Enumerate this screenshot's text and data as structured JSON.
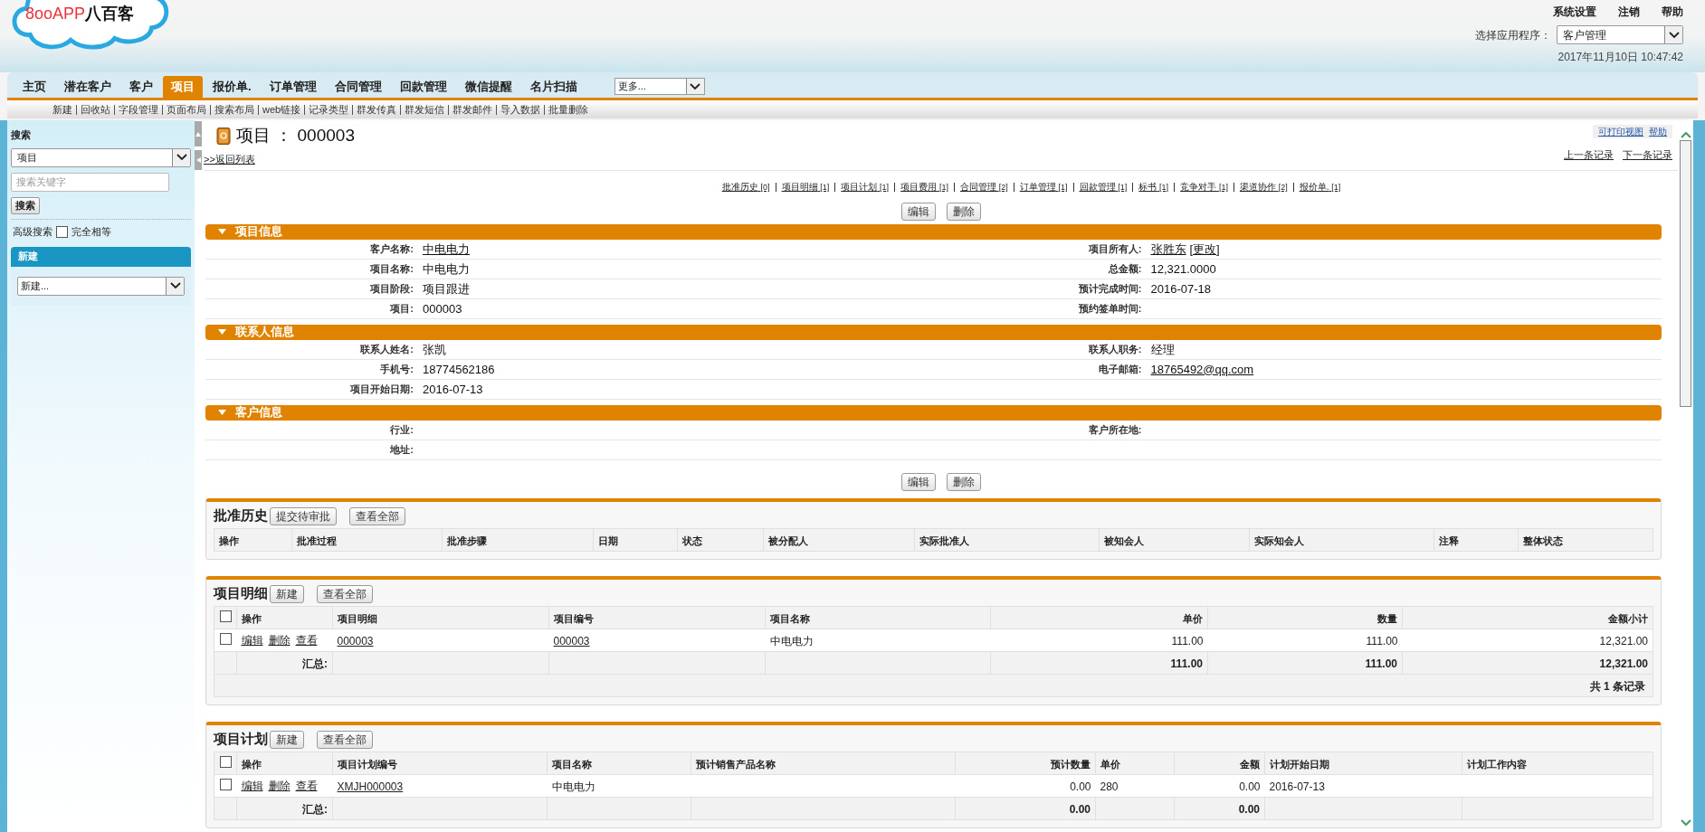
{
  "logo": {
    "latin": "8ooAPP",
    "cjk": "八百客"
  },
  "top_links": [
    "系统设置",
    "注销",
    "帮助"
  ],
  "app_selector": {
    "label": "选择应用程序：",
    "value": "客户管理"
  },
  "datetime": "2017年11月10日 10:47:42",
  "tabs": [
    {
      "label": "主页",
      "selected": false
    },
    {
      "label": "潜在客户",
      "selected": false
    },
    {
      "label": "客户",
      "selected": false
    },
    {
      "label": "项目",
      "selected": true
    },
    {
      "label": "报价单.",
      "selected": false
    },
    {
      "label": "订单管理",
      "selected": false
    },
    {
      "label": "合同管理",
      "selected": false
    },
    {
      "label": "回款管理",
      "selected": false
    },
    {
      "label": "微信提醒",
      "selected": false
    },
    {
      "label": "名片扫描",
      "selected": false
    }
  ],
  "more_select": "更多...",
  "subnav": [
    "新建",
    "回收站",
    "字段管理",
    "页面布局",
    "搜索布局",
    "web链接",
    "记录类型",
    "群发传真",
    "群发短信",
    "群发邮件",
    "导入数据",
    "批量删除"
  ],
  "sidebar": {
    "search_title": "搜索",
    "object_select": "项目",
    "search_placeholder": "搜索关键字",
    "search_button": "搜索",
    "advanced_link": "高级搜索",
    "exact_match": {
      "label": "完全相等",
      "checked": false
    },
    "new_title": "新建",
    "new_select": "新建..."
  },
  "record": {
    "title": "项目 ： 000003",
    "back_link": ">>返回列表",
    "print_link": "可打印视图",
    "help_link": "帮助",
    "prev_link": "上一条记录",
    "next_link": "下一条记录"
  },
  "related_links": [
    {
      "label": "批准历史",
      "count": "[0]"
    },
    {
      "label": "项目明细",
      "count": "[1]"
    },
    {
      "label": "项目计划",
      "count": "[1]"
    },
    {
      "label": "项目费用",
      "count": "[1]"
    },
    {
      "label": "合同管理",
      "count": "[2]"
    },
    {
      "label": "订单管理",
      "count": "[1]"
    },
    {
      "label": "回款管理",
      "count": "[1]"
    },
    {
      "label": "标书",
      "count": "[1]"
    },
    {
      "label": "竞争对手",
      "count": "[1]"
    },
    {
      "label": "渠道协作",
      "count": "[2]"
    },
    {
      "label": "报价单.",
      "count": "[1]"
    }
  ],
  "top_buttons": [
    "编辑",
    "删除"
  ],
  "sections": [
    {
      "title": "项目信息",
      "expanded": true,
      "rows": [
        {
          "left": {
            "label": "客户名称:",
            "value": "中电电力",
            "link": true
          },
          "right": {
            "label": "项目所有人:",
            "value": "张胜东",
            "link": true,
            "extra_link": "[更改]"
          }
        },
        {
          "left": {
            "label": "项目名称:",
            "value": "中电电力",
            "link": false
          },
          "right": {
            "label": "总金额:",
            "value": "12,321.0000",
            "link": false
          }
        },
        {
          "left": {
            "label": "项目阶段:",
            "value": "项目跟进",
            "link": false
          },
          "right": {
            "label": "预计完成时间:",
            "value": "2016-07-18",
            "link": false
          }
        },
        {
          "left": {
            "label": "项目:",
            "value": "000003",
            "link": false
          },
          "right": {
            "label": "预约签单时间:"
          }
        }
      ]
    },
    {
      "title": "联系人信息",
      "expanded": true,
      "rows": [
        {
          "left": {
            "label": "联系人姓名:",
            "value": "张凯",
            "link": false
          },
          "right": {
            "label": "联系人职务:",
            "value": "经理",
            "link": false
          }
        },
        {
          "left": {
            "label": "手机号:",
            "value": "18774562186",
            "link": false
          },
          "right": {
            "label": "电子邮箱:",
            "value": "18765492@qq.com",
            "link": true
          }
        },
        {
          "left": {
            "label": "项目开始日期:",
            "value": "2016-07-13",
            "link": false
          }
        }
      ]
    },
    {
      "title": "客户信息",
      "expanded": true,
      "rows": [
        {
          "left": {
            "label": "行业:"
          },
          "right": {
            "label": "客户所在地:"
          }
        },
        {
          "left": {
            "label": "地址:"
          }
        }
      ]
    }
  ],
  "bottom_buttons": [
    "编辑",
    "删除"
  ],
  "related_lists": [
    {
      "title": "批准历史",
      "buttons": [
        "提交待审批",
        "查看全部"
      ],
      "columns": [
        "操作",
        "批准过程",
        "批准步骤",
        "日期",
        "状态",
        "被分配人",
        "实际批准人",
        "被知会人",
        "实际知会人",
        "注释",
        "整体状态"
      ]
    },
    {
      "title": "项目明细",
      "buttons": [
        "新建",
        "查看全部"
      ],
      "columns": [
        {
          "kind": "checkbox",
          "checked": false
        },
        "操作",
        "项目明细",
        "项目编号",
        "项目名称",
        "单价",
        "数量",
        "金额小计"
      ],
      "rows": [
        {
          "cells": [
            {
              "kind": "checkbox",
              "checked": false
            },
            {
              "kind": "actions",
              "actions": [
                "编辑",
                "删除",
                "查看"
              ]
            },
            {
              "kind": "link",
              "text": "000003"
            },
            {
              "kind": "link",
              "text": "000003"
            },
            {
              "kind": "text",
              "text": "中电电力"
            },
            {
              "kind": "text",
              "text": "111.00"
            },
            {
              "kind": "text",
              "text": "111.00"
            },
            {
              "kind": "text",
              "text": "12,321.00"
            }
          ]
        }
      ],
      "summary": [
        {
          "kind": "empty"
        },
        "汇总:",
        {
          "kind": "empty"
        },
        {
          "kind": "empty"
        },
        {
          "kind": "empty"
        },
        "111.00",
        "111.00",
        "12,321.00"
      ],
      "footer": "共 1 条记录"
    },
    {
      "title": "项目计划",
      "buttons": [
        "新建",
        "查看全部"
      ],
      "columns": [
        {
          "kind": "checkbox",
          "checked": false
        },
        "操作",
        "项目计划编号",
        "项目名称",
        "预计销售产品名称",
        "预计数量",
        "单价",
        "金额",
        "计划开始日期",
        "计划工作内容"
      ],
      "rows": [
        {
          "cells": [
            {
              "kind": "checkbox",
              "checked": false
            },
            {
              "kind": "actions",
              "actions": [
                "编辑",
                "删除",
                "查看"
              ]
            },
            {
              "kind": "link",
              "text": "XMJH000003"
            },
            {
              "kind": "text",
              "text": "中电电力"
            },
            {
              "kind": "empty"
            },
            {
              "kind": "text",
              "text": "0.00"
            },
            {
              "kind": "text",
              "text": "280"
            },
            {
              "kind": "text",
              "text": "0.00"
            },
            {
              "kind": "text",
              "text": "2016-07-13"
            },
            {
              "kind": "empty"
            }
          ]
        }
      ],
      "summary": [
        {
          "kind": "empty"
        },
        "汇总:",
        {
          "kind": "empty"
        },
        {
          "kind": "empty"
        },
        {
          "kind": "empty"
        },
        "0.00",
        {
          "kind": "empty"
        },
        "0.00",
        {
          "kind": "empty"
        },
        {
          "kind": "empty"
        }
      ]
    }
  ]
}
